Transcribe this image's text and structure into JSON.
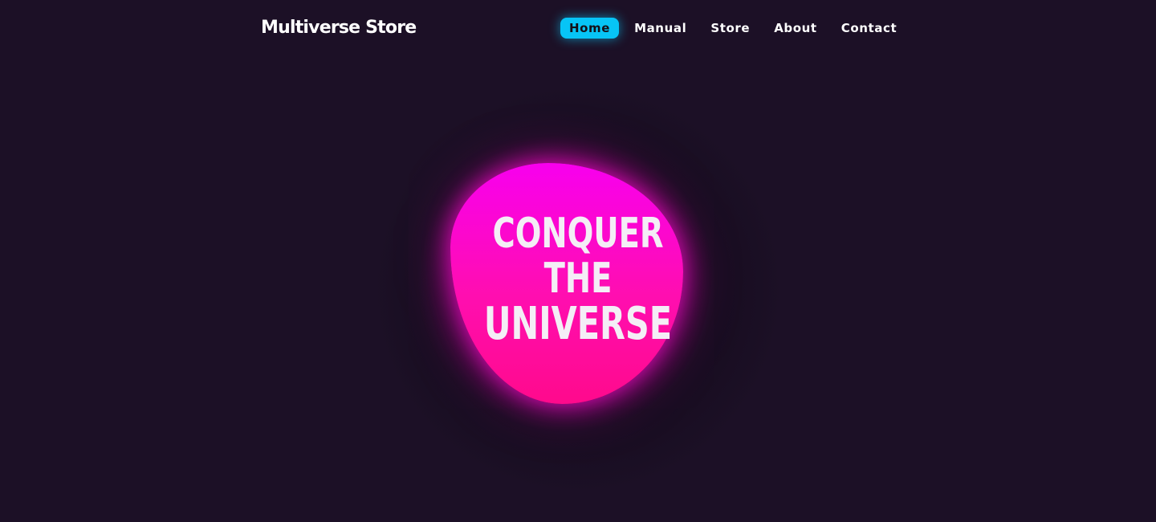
{
  "header": {
    "brand": "Multiverse Store",
    "nav": [
      {
        "label": "Home",
        "active": true
      },
      {
        "label": "Manual",
        "active": false
      },
      {
        "label": "Store",
        "active": false
      },
      {
        "label": "About",
        "active": false
      },
      {
        "label": "Contact",
        "active": false
      }
    ]
  },
  "hero": {
    "line1": "CONQUER",
    "line2": "THE",
    "line3": "UNIVERSE"
  },
  "colors": {
    "background": "#1c1026",
    "accent_nav": "#07c4f6",
    "blob_top": "#f800ee",
    "blob_bottom": "#ff0a8c",
    "text": "#ffffff"
  }
}
